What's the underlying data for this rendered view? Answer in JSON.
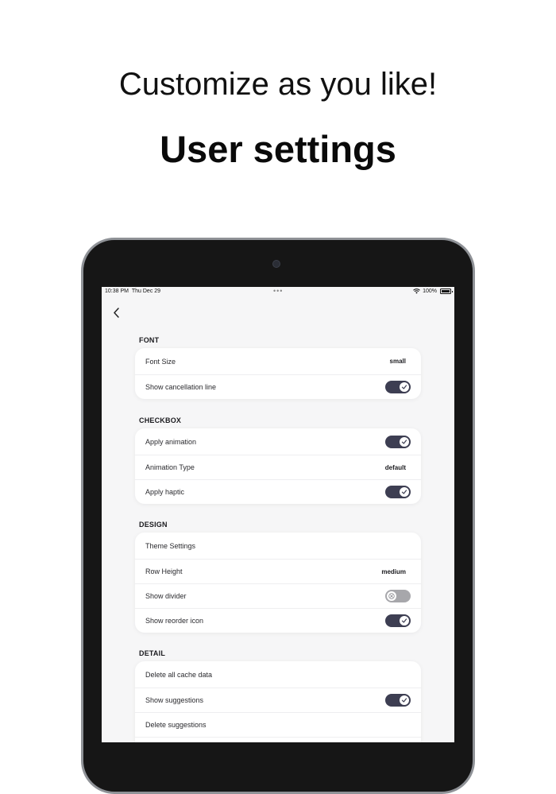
{
  "headline": "Customize as you like!",
  "title": "User settings",
  "status_bar": {
    "time": "10:38 PM",
    "date": "Thu Dec 29",
    "battery": "100%",
    "more": "•••"
  },
  "sections": {
    "font": {
      "title": "FONT",
      "font_size": {
        "label": "Font Size",
        "value": "small"
      },
      "show_cancellation_line": {
        "label": "Show cancellation line",
        "on": true
      }
    },
    "checkbox": {
      "title": "CHECKBOX",
      "apply_animation": {
        "label": "Apply animation",
        "on": true
      },
      "animation_type": {
        "label": "Animation Type",
        "value": "default"
      },
      "apply_haptic": {
        "label": "Apply haptic",
        "on": true
      }
    },
    "design": {
      "title": "DESIGN",
      "theme_settings": {
        "label": "Theme Settings"
      },
      "row_height": {
        "label": "Row Height",
        "value": "medium"
      },
      "show_divider": {
        "label": "Show divider",
        "on": false
      },
      "show_reorder_icon": {
        "label": "Show reorder icon",
        "on": true
      }
    },
    "detail": {
      "title": "DETAIL",
      "delete_all_cache": {
        "label": "Delete all cache data"
      },
      "show_suggestions": {
        "label": "Show suggestions",
        "on": true
      },
      "delete_suggestions": {
        "label": "Delete suggestions"
      }
    }
  },
  "colors": {
    "toggle_on": "#3d3e52",
    "toggle_off": "#a7a7ab",
    "device_frame": "#161616"
  },
  "icons": [
    "chevron-left-icon",
    "wifi-icon",
    "battery-icon",
    "checkmark-icon",
    "x-icon"
  ]
}
